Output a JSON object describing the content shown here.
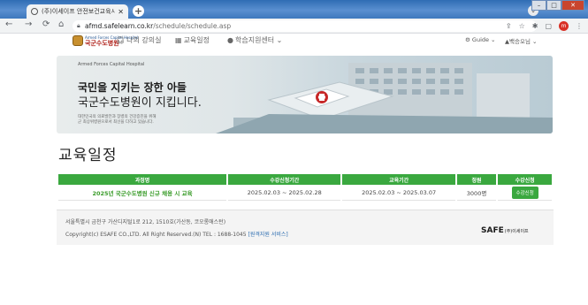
{
  "browser": {
    "tab_title": "(주)이세이프 안전보건교육시스템",
    "url_domain": "afmd.safelearn.co.kr",
    "url_path": "/schedule/schedule.asp",
    "profile_initial": "m"
  },
  "site": {
    "logo_name": "국군수도병원",
    "logo_sub": "Armed Forces Capital Hospital",
    "menu": [
      {
        "icon": "headset-icon",
        "label": "나의 강의실"
      },
      {
        "icon": "calendar-icon",
        "label": "교육일정"
      },
      {
        "icon": "info-icon",
        "label": "학습지원센터 ⌄"
      }
    ],
    "guide_label": "Guide ⌄",
    "user_label": "백승오님 ⌄"
  },
  "banner": {
    "top_text": "Armed Forces Capital Hospital",
    "title_line1": "국민을 지키는 장한 아들",
    "title_line2": "국군수도병원이 지킵니다.",
    "desc_line1": "대한민국의 의료발전과 장병의 건강증진을 위해",
    "desc_line2": "군 최상위병원으로서 최선을 다하고 있습니다."
  },
  "page_title": "교육일정",
  "table": {
    "headers": [
      "과정명",
      "수강신청기간",
      "교육기간",
      "정원",
      "수강신청"
    ],
    "rows": [
      {
        "course": "2025년 국군수도병원 신규 채용 시 교육",
        "apply_period": "2025.02.03 ~ 2025.02.28",
        "edu_period": "2025.02.03 ~ 2025.03.07",
        "capacity": "3000명",
        "button": "수강신청"
      }
    ]
  },
  "footer": {
    "address": "서울특별시 금천구 가산디지털1로 212, 1510호(가산동, 코오롱애스턴)",
    "copyright": "Copyright(c) ESAFE CO.,LTD. All Right Reserved.(N) TEL : 1688-1045 ",
    "remote_link": "[원격지원 서비스]",
    "logo": "SAFE",
    "logo_sub": "(주)이세이프"
  },
  "colors": {
    "accent": "#3aa83f",
    "title_bar": "#3d78bd"
  }
}
